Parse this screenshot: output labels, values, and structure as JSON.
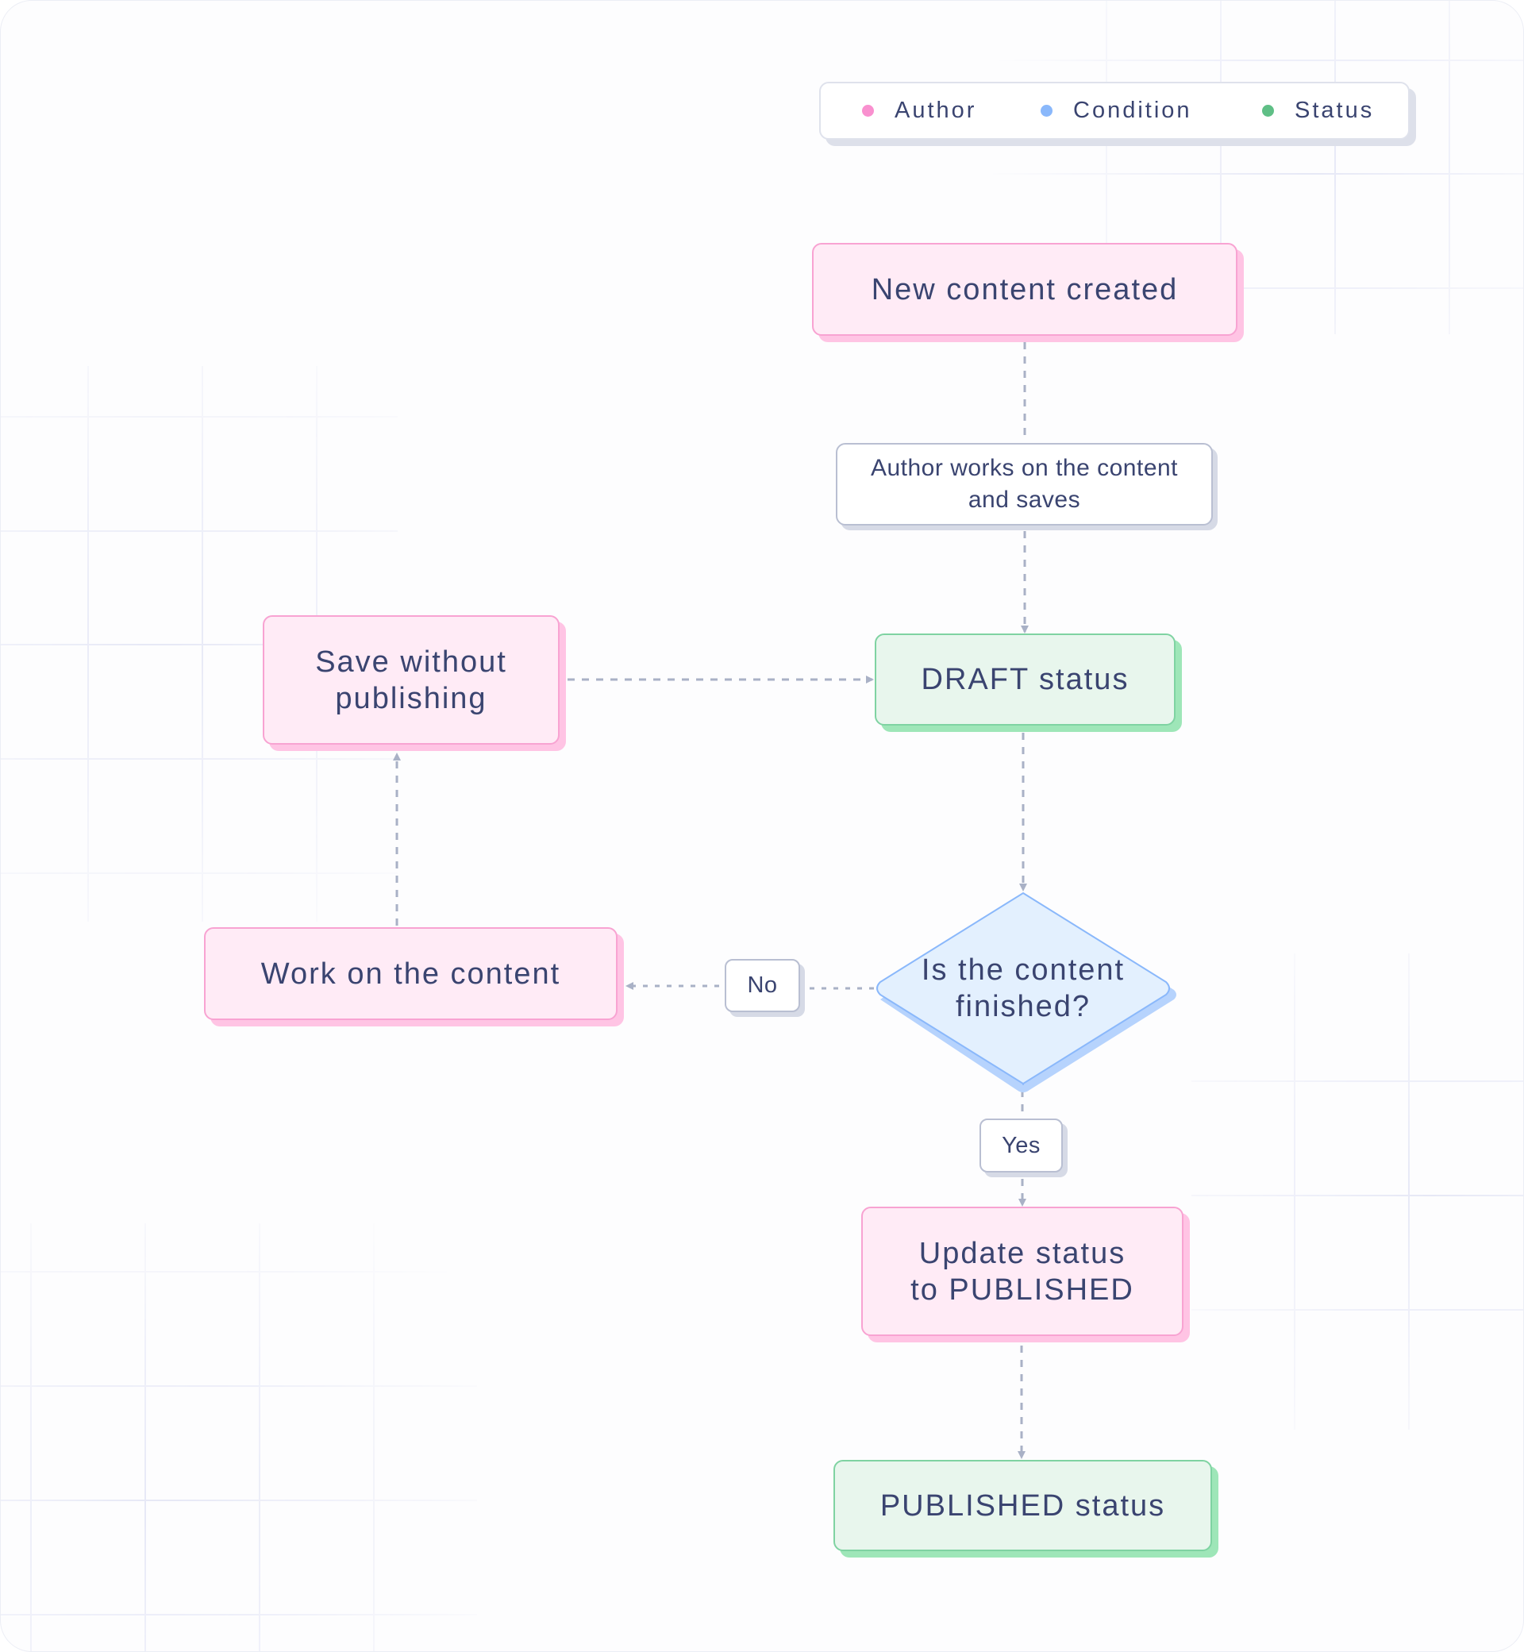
{
  "legend": {
    "items": [
      {
        "label": "Author",
        "color": "#f990cf",
        "icon": "author-dot"
      },
      {
        "label": "Condition",
        "color": "#8ab8fb",
        "icon": "condition-dot"
      },
      {
        "label": "Status",
        "color": "#5fbf86",
        "icon": "status-dot"
      }
    ]
  },
  "nodes": {
    "new_content": {
      "type": "author",
      "lines": [
        "New content created"
      ]
    },
    "author_works": {
      "type": "plain",
      "lines": [
        "Author works on the content",
        "and saves"
      ]
    },
    "draft_status": {
      "type": "status",
      "lines": [
        "DRAFT status"
      ]
    },
    "save_without_publishing": {
      "type": "author",
      "lines": [
        "Save without",
        "publishing"
      ]
    },
    "work_on_content": {
      "type": "author",
      "lines": [
        "Work on the content"
      ]
    },
    "is_finished": {
      "type": "condition",
      "lines": [
        "Is the content",
        "finished?"
      ]
    },
    "update_status": {
      "type": "author",
      "lines": [
        "Update status",
        "to PUBLISHED"
      ]
    },
    "published_status": {
      "type": "status",
      "lines": [
        "PUBLISHED status"
      ]
    }
  },
  "edge_labels": {
    "no": "No",
    "yes": "Yes"
  },
  "edges": [
    {
      "from": "new_content",
      "to": "author_works"
    },
    {
      "from": "author_works",
      "to": "draft_status"
    },
    {
      "from": "draft_status",
      "to": "is_finished"
    },
    {
      "from": "is_finished",
      "to": "work_on_content",
      "label": "No"
    },
    {
      "from": "work_on_content",
      "to": "save_without_publishing"
    },
    {
      "from": "save_without_publishing",
      "to": "draft_status"
    },
    {
      "from": "is_finished",
      "to": "update_status",
      "label": "Yes"
    },
    {
      "from": "update_status",
      "to": "published_status"
    }
  ],
  "colors": {
    "author_fill": "#ffebf6",
    "author_border": "#f8a3d2",
    "condition_fill": "#e3f0fe",
    "condition_border": "#8ab8fb",
    "status_fill": "#e8f6ed",
    "status_border": "#7fd3a2",
    "edge": "#a9b1c6",
    "text": "#3a4470"
  }
}
